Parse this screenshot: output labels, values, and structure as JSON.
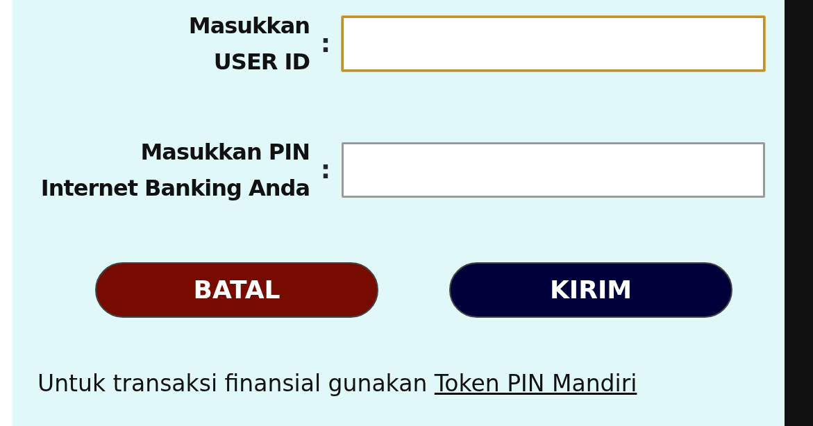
{
  "fields": [
    {
      "label_lines": [
        "Masukkan",
        "USER ID"
      ],
      "separator": ":",
      "focused": true
    },
    {
      "label_lines": [
        "Masukkan PIN",
        "Internet Banking Anda"
      ],
      "separator": ":",
      "focused": false
    }
  ],
  "buttons": [
    {
      "label": "BATAL",
      "kind": "cancel"
    },
    {
      "label": "KIRIM",
      "kind": "submit"
    }
  ],
  "note": {
    "text": "Untuk transaksi finansial gunakan",
    "link": "Token PIN Mandiri"
  }
}
